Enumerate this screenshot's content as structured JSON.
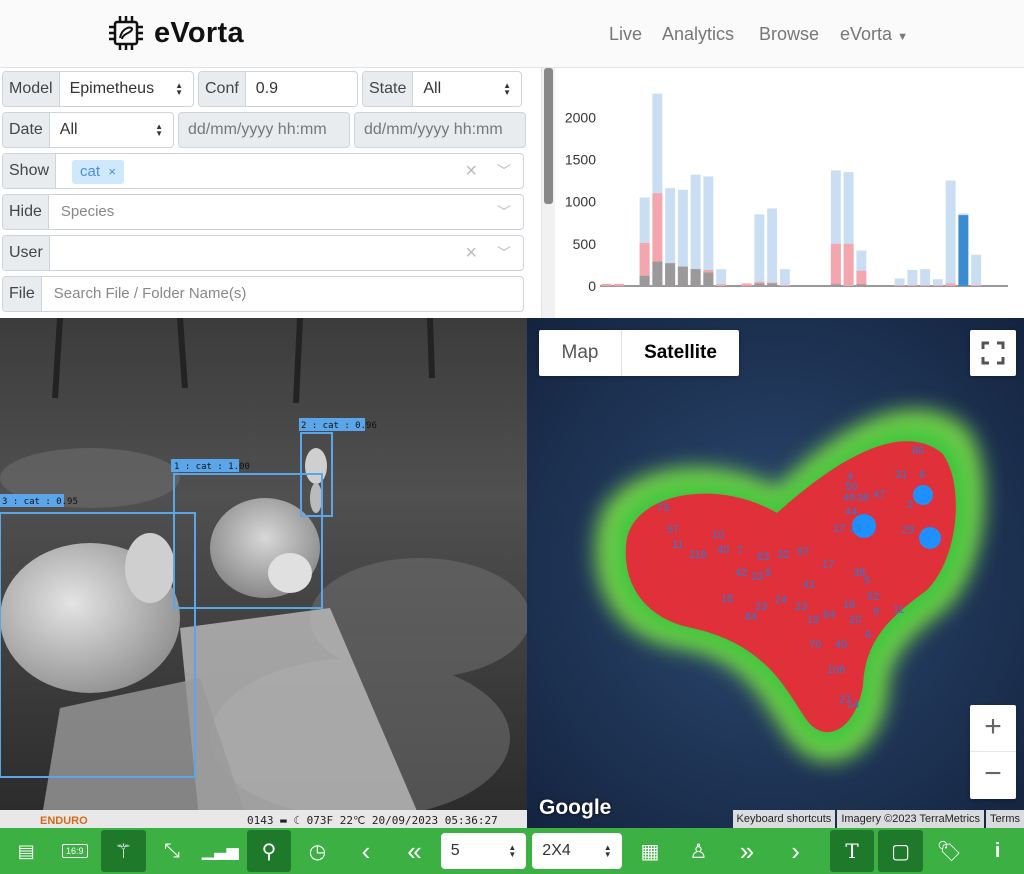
{
  "nav": {
    "brand": "eVorta",
    "links": [
      "Live",
      "Analytics",
      "Browse",
      "eVorta"
    ]
  },
  "filters": {
    "model": {
      "label": "Model",
      "value": "Epimetheus"
    },
    "conf": {
      "label": "Conf",
      "value": "0.9"
    },
    "state": {
      "label": "State",
      "value": "All"
    },
    "date": {
      "label": "Date",
      "value": "All",
      "from_placeholder": "dd/mm/yyyy hh:mm",
      "to_placeholder": "dd/mm/yyyy hh:mm"
    },
    "show": {
      "label": "Show",
      "tags": [
        "cat"
      ]
    },
    "hide": {
      "label": "Hide",
      "placeholder": "Species"
    },
    "user": {
      "label": "User",
      "placeholder": ""
    },
    "file": {
      "label": "File",
      "placeholder": "Search File / Folder Name(s)"
    }
  },
  "chart_data": {
    "type": "bar",
    "ylim": [
      0,
      2300
    ],
    "yticks": [
      0,
      500,
      1000,
      1500,
      2000
    ],
    "bin_count": 32,
    "series": [
      {
        "color": "#c9def2",
        "values": [
          25,
          25,
          0,
          1050,
          2280,
          1160,
          1140,
          1320,
          1300,
          200,
          0,
          30,
          850,
          920,
          200,
          0,
          0,
          0,
          1370,
          1350,
          420,
          0,
          0,
          90,
          190,
          200,
          80,
          1250,
          860,
          370,
          0,
          0
        ]
      },
      {
        "color": "#f3a6ad",
        "values": [
          25,
          25,
          0,
          510,
          1100,
          270,
          230,
          200,
          190,
          20,
          0,
          30,
          50,
          40,
          10,
          0,
          0,
          0,
          500,
          500,
          180,
          0,
          0,
          10,
          10,
          10,
          10,
          30,
          20,
          10,
          0,
          0
        ]
      },
      {
        "color": "#9a9a9a",
        "values": [
          0,
          0,
          0,
          120,
          290,
          270,
          230,
          200,
          160,
          0,
          0,
          0,
          30,
          30,
          0,
          0,
          0,
          0,
          20,
          0,
          20,
          0,
          0,
          0,
          0,
          0,
          0,
          0,
          0,
          0,
          0,
          0
        ]
      },
      {
        "color": "#3a8bd0",
        "values": [
          0,
          0,
          0,
          0,
          0,
          0,
          0,
          0,
          0,
          0,
          0,
          0,
          0,
          0,
          0,
          0,
          0,
          0,
          0,
          0,
          0,
          0,
          0,
          0,
          0,
          0,
          0,
          0,
          840,
          0,
          0,
          0
        ]
      }
    ]
  },
  "photo": {
    "detections": [
      "1 : cat : 1.00",
      "2 : cat : 0.96",
      "3 : cat : 0.95"
    ],
    "camera_brand": "ENDURO",
    "info_strip": "0143 ▬ ☾ 073F 22℃ 20/09/2023 05:36:27"
  },
  "map": {
    "type_buttons": [
      "Map",
      "Satellite"
    ],
    "active_type": "Satellite",
    "google_logo": "Google",
    "attributions": [
      "Keyboard shortcuts",
      "Imagery ©2023 TerraMetrics",
      "Terms"
    ],
    "zoom_in": "+",
    "zoom_out": "−",
    "point_labels": [
      "86",
      "31",
      "6",
      "4",
      "50",
      "49",
      "38",
      "47",
      "44",
      "2",
      "29",
      "17",
      "13",
      "73",
      "57",
      "11",
      "10",
      "40",
      "7",
      "63",
      "32",
      "97",
      "118",
      "33",
      "42",
      "6",
      "17",
      "38",
      "5",
      "41",
      "52",
      "24",
      "18",
      "23",
      "84",
      "23",
      "19",
      "64",
      "16",
      "20",
      "9",
      "11",
      "70",
      "40",
      "106",
      "27",
      "14",
      "6"
    ]
  },
  "toolbar": {
    "per_page": "5",
    "grid": "2X4"
  }
}
